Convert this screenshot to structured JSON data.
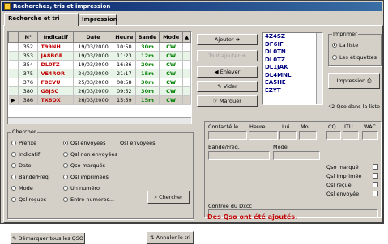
{
  "window": {
    "title": "Recherches, tris et impression"
  },
  "tabs": [
    {
      "label": "Recherche et tri"
    },
    {
      "label": "Impression"
    }
  ],
  "table": {
    "headers": [
      "N°",
      "Indicatif",
      "Date",
      "Heure",
      "Bande",
      "Mode"
    ],
    "rows": [
      [
        "352",
        "T99NH",
        "19/03/2000",
        "10:50",
        "30m",
        "CW"
      ],
      [
        "353",
        "JA8BGR",
        "19/03/2000",
        "11:23",
        "12m",
        "CW"
      ],
      [
        "354",
        "DL0TZ",
        "19/03/2000",
        "16:36",
        "20m",
        "CW"
      ],
      [
        "375",
        "VE4ROR",
        "24/03/2000",
        "21:17",
        "15m",
        "CW"
      ],
      [
        "376",
        "F8CVU",
        "25/03/2000",
        "08:58",
        "30m",
        "CW"
      ],
      [
        "380",
        "G8JSC",
        "26/03/2000",
        "09:52",
        "30m",
        "CW"
      ],
      [
        "386",
        "TX8DX",
        "26/03/2000",
        "15:59",
        "15m",
        "CW"
      ]
    ]
  },
  "buttons": {
    "ajouter": "Ajouter",
    "ajouter_tous": "Tout ajouter",
    "enlever": "Enlever",
    "vider": "Vider",
    "marquer": "Marquer",
    "chercher": "Chercher",
    "annuler_tri": "Annuler le tri",
    "demarquer": "Démarquer tous les QSO",
    "impression": "Impression"
  },
  "callsign_list": [
    "4Z4SZ",
    "DF6IF",
    "DL0TN",
    "DL0TZ",
    "DL1JAK",
    "DL4MNL",
    "EA5HE",
    "EZYT"
  ],
  "imprimer": {
    "label": "Imprimer",
    "options": [
      {
        "label": "La liste",
        "selected": true
      },
      {
        "label": "Les étiquettes",
        "selected": false
      }
    ]
  },
  "qso_count": "42 Qso dans la liste",
  "chercher": {
    "label": "Chercher",
    "col1": [
      {
        "label": "Préfixe",
        "selected": false
      },
      {
        "label": "Indicatif",
        "selected": false
      },
      {
        "label": "Date",
        "selected": false
      },
      {
        "label": "Bande/Fréq.",
        "selected": false
      },
      {
        "label": "Mode",
        "selected": false
      },
      {
        "label": "Qsl reçues",
        "selected": false
      }
    ],
    "col2": [
      {
        "label": "Qsl envoyées",
        "selected": true
      },
      {
        "label": "Qsl non envoyées",
        "selected": false
      },
      {
        "label": "Qso marqués",
        "selected": false
      },
      {
        "label": "Qsl imprimées",
        "selected": false
      },
      {
        "label": "Un numéro",
        "selected": false
      },
      {
        "label": "Entre numéros...",
        "selected": false
      }
    ],
    "current": "Qsl envoyées"
  },
  "detail": {
    "contacte_le": "Contacté le",
    "heure": "Heure",
    "lui": "Lui",
    "moi": "Moi",
    "cq": "CQ",
    "itu": "ITU",
    "wac": "WAC",
    "bande": "Bande/Fréq.",
    "mode": "Mode",
    "contree": "Contrée du Dxcc",
    "checks": [
      "Qso marqué",
      "Qsl imprimée",
      "Qsl reçue",
      "Qsl envoyée"
    ]
  },
  "status": "Des Qso ont été ajoutés.",
  "colors": {
    "callsign": "#c00000",
    "band": "#008000",
    "title_bar": "#0a246a",
    "list_text": "#000080"
  }
}
